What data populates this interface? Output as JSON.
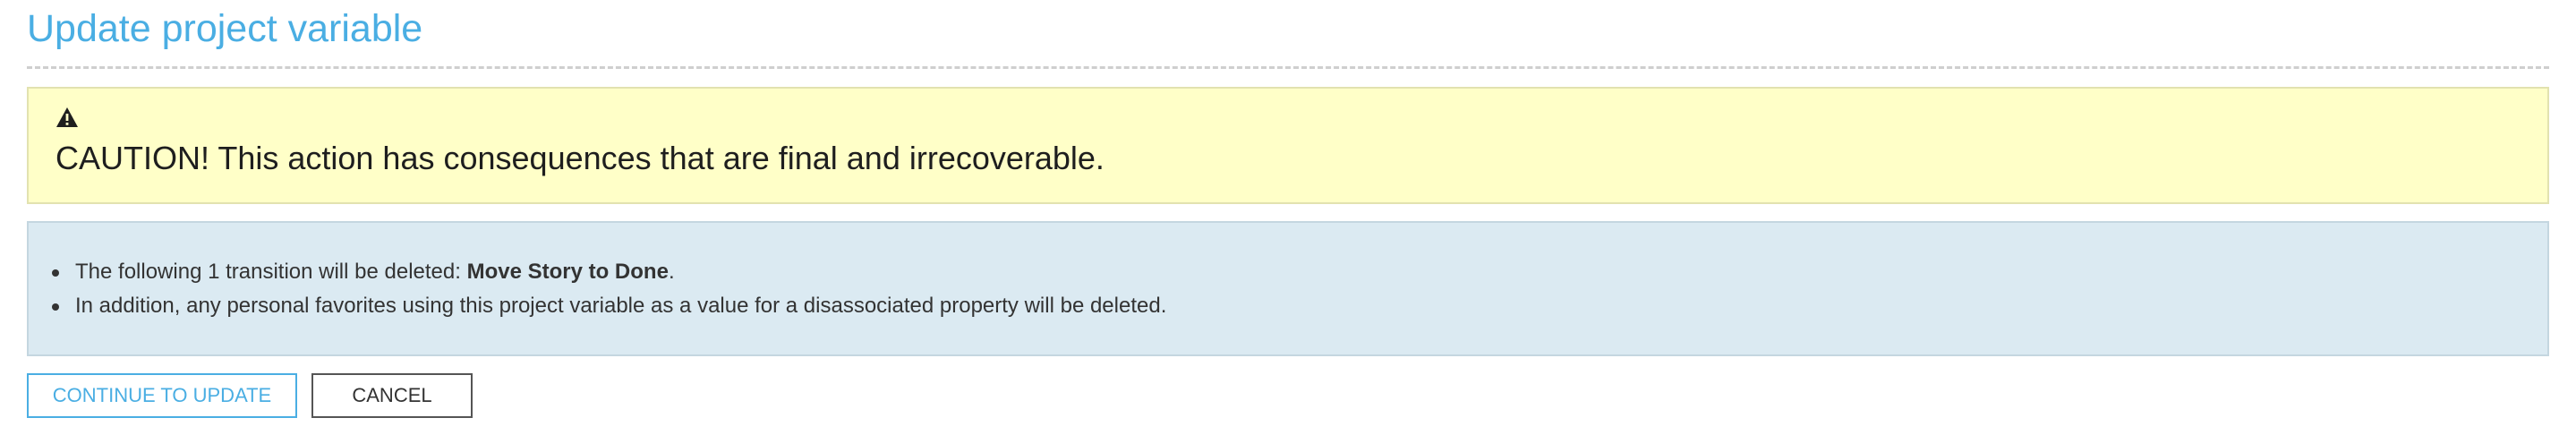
{
  "page": {
    "title": "Update project variable"
  },
  "caution": {
    "icon": "warning-triangle-icon",
    "message": "CAUTION! This action has consequences that are final and irrecoverable.",
    "background_color": "#ffffc8"
  },
  "info": {
    "background_color": "#dbeaf2",
    "items": [
      {
        "prefix": "The following 1 transition will be deleted: ",
        "bold": "Move Story to Done",
        "suffix": "."
      },
      {
        "prefix": "In addition, any personal favorites using this project variable as a value for a disassociated property will be deleted.",
        "bold": "",
        "suffix": ""
      }
    ]
  },
  "actions": {
    "continue_label": "CONTINUE TO UPDATE",
    "cancel_label": "CANCEL",
    "accent_color": "#4aaee3"
  }
}
